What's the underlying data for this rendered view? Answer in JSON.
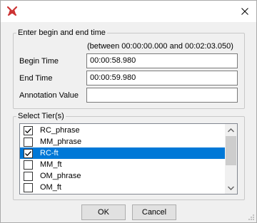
{
  "window": {
    "title": ""
  },
  "time_section": {
    "legend": "Enter begin and end time",
    "range_note": "(between 00:00:00.000 and 00:02:03.050)",
    "begin_label": "Begin Time",
    "begin_value": "00:00:58.980",
    "end_label": "End Time",
    "end_value": "00:00:59.980",
    "annotation_label": "Annotation Value",
    "annotation_value": ""
  },
  "tier_section": {
    "legend": "Select Tier(s)",
    "tiers": [
      {
        "label": "RC_phrase",
        "checked": true,
        "selected": false
      },
      {
        "label": "MM_phrase",
        "checked": false,
        "selected": false
      },
      {
        "label": "RC-ft",
        "checked": true,
        "selected": true
      },
      {
        "label": "MM_ft",
        "checked": false,
        "selected": false
      },
      {
        "label": "OM_phrase",
        "checked": false,
        "selected": false
      },
      {
        "label": "OM_ft",
        "checked": false,
        "selected": false
      }
    ]
  },
  "buttons": {
    "ok_label": "OK",
    "cancel_label": "Cancel"
  },
  "colors": {
    "selection": "#0078d7",
    "app_icon": "#cc3333"
  }
}
